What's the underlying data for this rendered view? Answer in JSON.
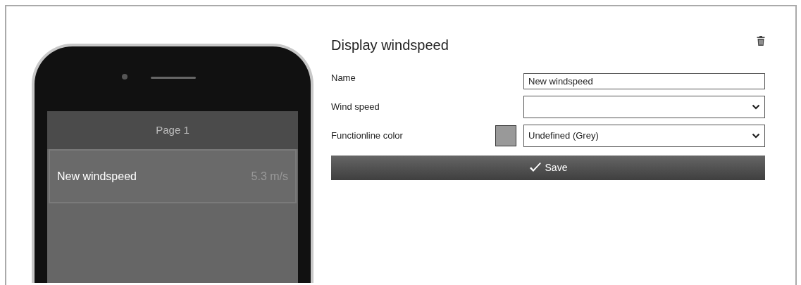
{
  "phone": {
    "page_title": "Page 1",
    "items": [
      {
        "name": "New windspeed",
        "value": "5.3 m/s"
      }
    ]
  },
  "editor": {
    "title": "Display windspeed",
    "fields": [
      {
        "kind": "text",
        "label": "Name",
        "value": "New windspeed"
      },
      {
        "kind": "select",
        "label": "Wind speed"
      },
      {
        "kind": "color",
        "label": "Functionline color",
        "value": "Undefined (Grey)",
        "color": "#999999"
      }
    ],
    "save_label": "Save"
  }
}
